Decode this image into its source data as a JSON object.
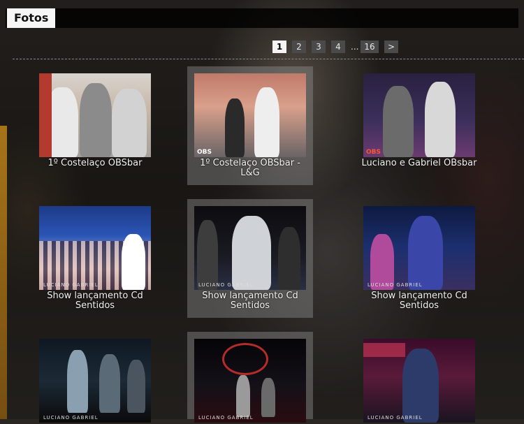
{
  "section": {
    "title": "Fotos"
  },
  "pagination": {
    "pages": [
      "1",
      "2",
      "3",
      "4"
    ],
    "ellipsis": "...",
    "last": "16",
    "next": ">",
    "current": "1"
  },
  "gallery": {
    "items": [
      {
        "caption": "1º Costelaço OBSbar"
      },
      {
        "caption": "1º Costelaço OBSbar - L&G"
      },
      {
        "caption": "Luciano e Gabriel OBsbar"
      },
      {
        "caption": "Show lançamento Cd Sentidos"
      },
      {
        "caption": "Show lançamento Cd Sentidos"
      },
      {
        "caption": "Show lançamento Cd Sentidos"
      },
      {
        "caption": ""
      },
      {
        "caption": ""
      },
      {
        "caption": ""
      }
    ]
  },
  "colors": {
    "active_page_bg": "#f4f4f4",
    "page_bg": "#4a4a4a",
    "header_bg": "#000000",
    "caption_text": "#f2f2f2"
  }
}
